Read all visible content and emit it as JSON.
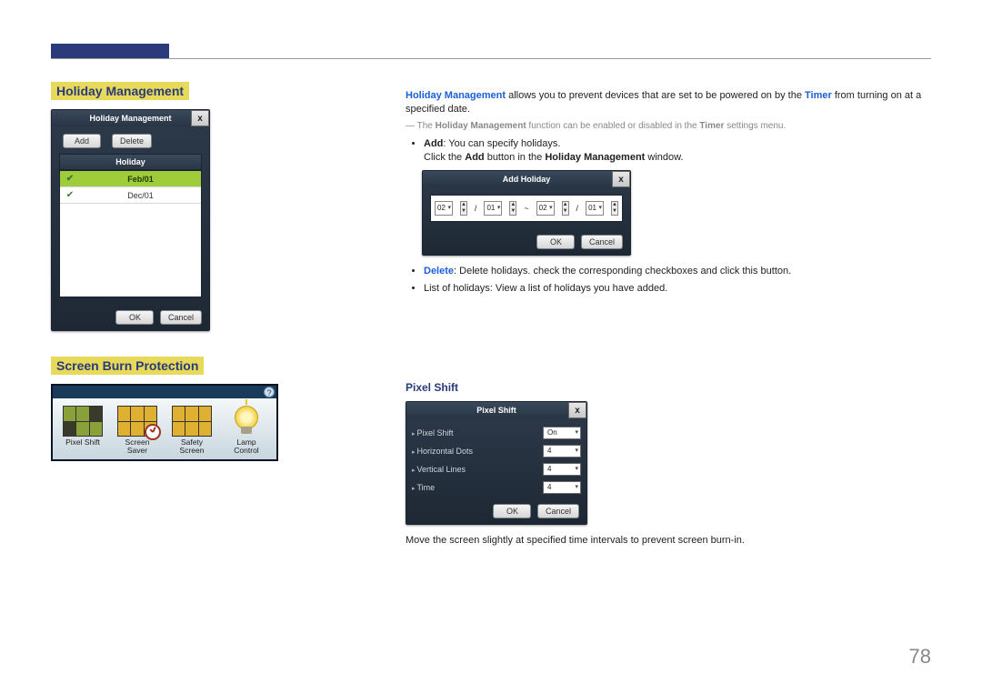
{
  "page_number": "78",
  "headings": {
    "holiday_management": "Holiday Management",
    "screen_burn_protection": "Screen Burn Protection",
    "pixel_shift": "Pixel Shift"
  },
  "hm_dialog": {
    "title": "Holiday Management",
    "add_btn": "Add",
    "delete_btn": "Delete",
    "list_header": "Holiday",
    "rows": [
      {
        "date": "Feb/01",
        "selected": true
      },
      {
        "date": "Dec/01",
        "selected": false
      }
    ],
    "ok": "OK",
    "cancel": "Cancel"
  },
  "add_holiday_dialog": {
    "title": "Add Holiday",
    "from_m": "02",
    "from_d": "01",
    "to_m": "02",
    "to_d": "01",
    "ok": "OK",
    "cancel": "Cancel"
  },
  "right_text": {
    "p1_a": "Holiday Management",
    "p1_b": " allows you to prevent devices that are set to be powered on by the ",
    "p1_c": "Timer",
    "p1_d": " from turning on at a specified date.",
    "note_a": "The ",
    "note_b": "Holiday Management",
    "note_c": " function can be enabled or disabled in the ",
    "note_d": "Timer",
    "note_e": " settings menu.",
    "add_bold": "Add",
    "add_rest": ": You can specify holidays.",
    "add_line2_a": "Click the ",
    "add_line2_b": "Add",
    "add_line2_c": " button in the ",
    "add_line2_d": "Holiday Management",
    "add_line2_e": " window.",
    "delete_bold": "Delete",
    "delete_rest": ": Delete holidays. check the corresponding checkboxes and click this button.",
    "list_bullet": "List of holidays: View a list of holidays you have added."
  },
  "sbp": {
    "items": [
      "Pixel Shift",
      "Screen Saver",
      "Safety Screen",
      "Lamp Control"
    ]
  },
  "pixel_shift_dialog": {
    "title": "Pixel Shift",
    "rows": [
      {
        "label": "Pixel Shift",
        "value": "On"
      },
      {
        "label": "Horizontal Dots",
        "value": "4"
      },
      {
        "label": "Vertical Lines",
        "value": "4"
      },
      {
        "label": "Time",
        "value": "4"
      }
    ],
    "ok": "OK",
    "cancel": "Cancel"
  },
  "pixel_shift_desc": "Move the screen slightly at specified time intervals to prevent screen burn-in."
}
